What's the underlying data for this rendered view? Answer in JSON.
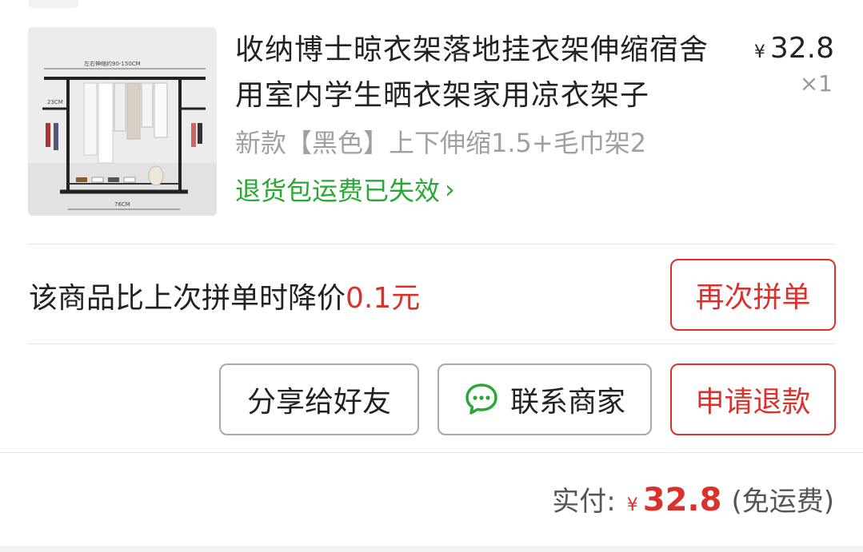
{
  "product": {
    "image_alt": "clothes-rack-photo",
    "image_labels": {
      "width_range": "左右伸缩约90-150CM",
      "side_label": "23CM",
      "base_width": "76CM"
    },
    "title": "收纳博士晾衣架落地挂衣架伸缩宿舍用室内学生晒衣架家用凉衣架子",
    "currency": "¥",
    "price": "32.8",
    "quantity": "×1",
    "spec": "新款【黑色】上下伸缩1.5+毛巾架2",
    "return_notice": "退货包运费已失效",
    "return_notice_chevron": "›"
  },
  "price_drop": {
    "text": "该商品比上次拼单时降价",
    "amount": "0.1元"
  },
  "buttons": {
    "reorder": "再次拼单",
    "share": "分享给好友",
    "contact": "联系商家",
    "refund": "申请退款"
  },
  "payment": {
    "label": "实付:",
    "currency": "¥",
    "amount": "32.8",
    "note": "(免运费)"
  },
  "colors": {
    "accent_red": "#d9312b",
    "success_green": "#2aa735",
    "wechat_green": "#2aa735"
  }
}
